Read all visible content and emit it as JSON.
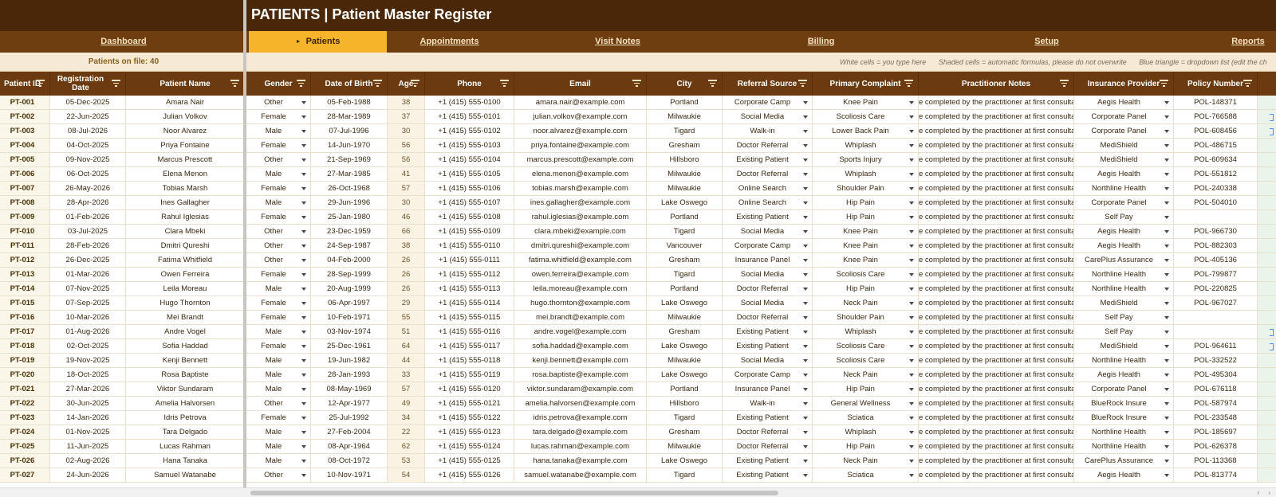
{
  "title": "PATIENTS  |  Patient Master Register",
  "nav": {
    "dashboard": "Dashboard",
    "patients": "Patients",
    "appointments": "Appointments",
    "visit_notes": "Visit Notes",
    "billing": "Billing",
    "setup": "Setup",
    "reports": "Reports"
  },
  "info": {
    "patients_on_file": "Patients on file: 40",
    "legend_white": "White cells = you type here",
    "legend_shaded": "Shaded cells = automatic formulas, please do not overwrite",
    "legend_dropdown": "Blue triangle = dropdown list (edit the ch"
  },
  "headers": {
    "patient_id": "Patient ID",
    "registration_date": "Registration Date",
    "patient_name": "Patient Name",
    "gender": "Gender",
    "date_of_birth": "Date of Birth",
    "age": "Age",
    "phone": "Phone",
    "email": "Email",
    "city": "City",
    "referral_source": "Referral Source",
    "primary_complaint": "Primary Complaint",
    "practitioner_notes": "Practitioner Notes",
    "insurance_provider": "Insurance Provider",
    "policy_number": "Policy Number"
  },
  "notes_text": "e completed by the practitioner at first consulta",
  "colors": {
    "title_bg": "#4a2708",
    "nav_bg": "#6e3d10",
    "active_tab": "#f6b42b",
    "header_bg": "#6b3a10",
    "info_bg": "#f6ead6"
  },
  "rows": [
    {
      "id": "PT-001",
      "reg": "05-Dec-2025",
      "name": "Amara Nair",
      "gender": "Other",
      "dob": "05-Feb-1988",
      "age": "38",
      "phone": "+1 (415) 555-0100",
      "email": "amara.nair@example.com",
      "city": "Portland",
      "referral": "Corporate Camp",
      "complaint": "Knee Pain",
      "insurance": "Aegis Health",
      "policy": "POL-148371",
      "mark": false
    },
    {
      "id": "PT-002",
      "reg": "22-Jun-2025",
      "name": "Julian Volkov",
      "gender": "Female",
      "dob": "28-Mar-1989",
      "age": "37",
      "phone": "+1 (415) 555-0101",
      "email": "julian.volkov@example.com",
      "city": "Milwaukie",
      "referral": "Social Media",
      "complaint": "Scoliosis Care",
      "insurance": "Corporate Panel",
      "policy": "POL-766588",
      "mark": true
    },
    {
      "id": "PT-003",
      "reg": "08-Jul-2026",
      "name": "Noor Alvarez",
      "gender": "Male",
      "dob": "07-Jul-1996",
      "age": "30",
      "phone": "+1 (415) 555-0102",
      "email": "noor.alvarez@example.com",
      "city": "Tigard",
      "referral": "Walk-in",
      "complaint": "Lower Back Pain",
      "insurance": "Corporate Panel",
      "policy": "POL-608456",
      "mark": true
    },
    {
      "id": "PT-004",
      "reg": "04-Oct-2025",
      "name": "Priya Fontaine",
      "gender": "Female",
      "dob": "14-Jun-1970",
      "age": "56",
      "phone": "+1 (415) 555-0103",
      "email": "priya.fontaine@example.com",
      "city": "Gresham",
      "referral": "Doctor Referral",
      "complaint": "Whiplash",
      "insurance": "MediShield",
      "policy": "POL-486715",
      "mark": false
    },
    {
      "id": "PT-005",
      "reg": "09-Nov-2025",
      "name": "Marcus Prescott",
      "gender": "Other",
      "dob": "21-Sep-1969",
      "age": "56",
      "phone": "+1 (415) 555-0104",
      "email": "marcus.prescott@example.com",
      "city": "Hillsboro",
      "referral": "Existing Patient",
      "complaint": "Sports Injury",
      "insurance": "MediShield",
      "policy": "POL-609634",
      "mark": false
    },
    {
      "id": "PT-006",
      "reg": "06-Oct-2025",
      "name": "Elena Menon",
      "gender": "Male",
      "dob": "27-Mar-1985",
      "age": "41",
      "phone": "+1 (415) 555-0105",
      "email": "elena.menon@example.com",
      "city": "Milwaukie",
      "referral": "Doctor Referral",
      "complaint": "Whiplash",
      "insurance": "Aegis Health",
      "policy": "POL-551812",
      "mark": false
    },
    {
      "id": "PT-007",
      "reg": "26-May-2026",
      "name": "Tobias Marsh",
      "gender": "Female",
      "dob": "26-Oct-1968",
      "age": "57",
      "phone": "+1 (415) 555-0106",
      "email": "tobias.marsh@example.com",
      "city": "Milwaukie",
      "referral": "Online Search",
      "complaint": "Shoulder Pain",
      "insurance": "Northline Health",
      "policy": "POL-240338",
      "mark": false
    },
    {
      "id": "PT-008",
      "reg": "28-Apr-2026",
      "name": "Ines Gallagher",
      "gender": "Male",
      "dob": "29-Jun-1996",
      "age": "30",
      "phone": "+1 (415) 555-0107",
      "email": "ines.gallagher@example.com",
      "city": "Lake Oswego",
      "referral": "Online Search",
      "complaint": "Hip Pain",
      "insurance": "Corporate Panel",
      "policy": "POL-504010",
      "mark": false
    },
    {
      "id": "PT-009",
      "reg": "01-Feb-2026",
      "name": "Rahul Iglesias",
      "gender": "Female",
      "dob": "25-Jan-1980",
      "age": "46",
      "phone": "+1 (415) 555-0108",
      "email": "rahul.iglesias@example.com",
      "city": "Portland",
      "referral": "Existing Patient",
      "complaint": "Hip Pain",
      "insurance": "Self Pay",
      "policy": "",
      "mark": false
    },
    {
      "id": "PT-010",
      "reg": "03-Jul-2025",
      "name": "Clara Mbeki",
      "gender": "Other",
      "dob": "23-Dec-1959",
      "age": "66",
      "phone": "+1 (415) 555-0109",
      "email": "clara.mbeki@example.com",
      "city": "Tigard",
      "referral": "Social Media",
      "complaint": "Knee Pain",
      "insurance": "Aegis Health",
      "policy": "POL-966730",
      "mark": false
    },
    {
      "id": "PT-011",
      "reg": "28-Feb-2026",
      "name": "Dmitri Qureshi",
      "gender": "Other",
      "dob": "24-Sep-1987",
      "age": "38",
      "phone": "+1 (415) 555-0110",
      "email": "dmitri.qureshi@example.com",
      "city": "Vancouver",
      "referral": "Corporate Camp",
      "complaint": "Knee Pain",
      "insurance": "Aegis Health",
      "policy": "POL-882303",
      "mark": false
    },
    {
      "id": "PT-012",
      "reg": "26-Dec-2025",
      "name": "Fatima Whitfield",
      "gender": "Other",
      "dob": "04-Feb-2000",
      "age": "26",
      "phone": "+1 (415) 555-0111",
      "email": "fatima.whitfield@example.com",
      "city": "Gresham",
      "referral": "Insurance Panel",
      "complaint": "Knee Pain",
      "insurance": "CarePlus Assurance",
      "policy": "POL-405136",
      "mark": false
    },
    {
      "id": "PT-013",
      "reg": "01-Mar-2026",
      "name": "Owen Ferreira",
      "gender": "Female",
      "dob": "28-Sep-1999",
      "age": "26",
      "phone": "+1 (415) 555-0112",
      "email": "owen.ferreira@example.com",
      "city": "Tigard",
      "referral": "Social Media",
      "complaint": "Scoliosis Care",
      "insurance": "Northline Health",
      "policy": "POL-799877",
      "mark": false
    },
    {
      "id": "PT-014",
      "reg": "07-Nov-2025",
      "name": "Leila Moreau",
      "gender": "Male",
      "dob": "20-Aug-1999",
      "age": "26",
      "phone": "+1 (415) 555-0113",
      "email": "leila.moreau@example.com",
      "city": "Portland",
      "referral": "Doctor Referral",
      "complaint": "Hip Pain",
      "insurance": "Northline Health",
      "policy": "POL-220825",
      "mark": false
    },
    {
      "id": "PT-015",
      "reg": "07-Sep-2025",
      "name": "Hugo Thornton",
      "gender": "Female",
      "dob": "06-Apr-1997",
      "age": "29",
      "phone": "+1 (415) 555-0114",
      "email": "hugo.thornton@example.com",
      "city": "Lake Oswego",
      "referral": "Social Media",
      "complaint": "Neck Pain",
      "insurance": "MediShield",
      "policy": "POL-967027",
      "mark": false
    },
    {
      "id": "PT-016",
      "reg": "10-Mar-2026",
      "name": "Mei Brandt",
      "gender": "Female",
      "dob": "10-Feb-1971",
      "age": "55",
      "phone": "+1 (415) 555-0115",
      "email": "mei.brandt@example.com",
      "city": "Milwaukie",
      "referral": "Doctor Referral",
      "complaint": "Shoulder Pain",
      "insurance": "Self Pay",
      "policy": "",
      "mark": false
    },
    {
      "id": "PT-017",
      "reg": "01-Aug-2026",
      "name": "Andre Vogel",
      "gender": "Male",
      "dob": "03-Nov-1974",
      "age": "51",
      "phone": "+1 (415) 555-0116",
      "email": "andre.vogel@example.com",
      "city": "Gresham",
      "referral": "Existing Patient",
      "complaint": "Whiplash",
      "insurance": "Self Pay",
      "policy": "",
      "mark": true
    },
    {
      "id": "PT-018",
      "reg": "02-Oct-2025",
      "name": "Sofia Haddad",
      "gender": "Female",
      "dob": "25-Dec-1961",
      "age": "64",
      "phone": "+1 (415) 555-0117",
      "email": "sofia.haddad@example.com",
      "city": "Lake Oswego",
      "referral": "Existing Patient",
      "complaint": "Scoliosis Care",
      "insurance": "MediShield",
      "policy": "POL-964611",
      "mark": true
    },
    {
      "id": "PT-019",
      "reg": "19-Nov-2025",
      "name": "Kenji Bennett",
      "gender": "Male",
      "dob": "19-Jun-1982",
      "age": "44",
      "phone": "+1 (415) 555-0118",
      "email": "kenji.bennett@example.com",
      "city": "Milwaukie",
      "referral": "Social Media",
      "complaint": "Scoliosis Care",
      "insurance": "Northline Health",
      "policy": "POL-332522",
      "mark": false
    },
    {
      "id": "PT-020",
      "reg": "18-Oct-2025",
      "name": "Rosa Baptiste",
      "gender": "Male",
      "dob": "28-Jan-1993",
      "age": "33",
      "phone": "+1 (415) 555-0119",
      "email": "rosa.baptiste@example.com",
      "city": "Lake Oswego",
      "referral": "Corporate Camp",
      "complaint": "Neck Pain",
      "insurance": "Aegis Health",
      "policy": "POL-495304",
      "mark": false
    },
    {
      "id": "PT-021",
      "reg": "27-Mar-2026",
      "name": "Viktor Sundaram",
      "gender": "Male",
      "dob": "08-May-1969",
      "age": "57",
      "phone": "+1 (415) 555-0120",
      "email": "viktor.sundaram@example.com",
      "city": "Portland",
      "referral": "Insurance Panel",
      "complaint": "Hip Pain",
      "insurance": "Corporate Panel",
      "policy": "POL-676118",
      "mark": false
    },
    {
      "id": "PT-022",
      "reg": "30-Jun-2025",
      "name": "Amelia Halvorsen",
      "gender": "Other",
      "dob": "12-Apr-1977",
      "age": "49",
      "phone": "+1 (415) 555-0121",
      "email": "amelia.halvorsen@example.com",
      "city": "Hillsboro",
      "referral": "Walk-in",
      "complaint": "General Wellness",
      "insurance": "BlueRock Insure",
      "policy": "POL-587974",
      "mark": false
    },
    {
      "id": "PT-023",
      "reg": "14-Jan-2026",
      "name": "Idris Petrova",
      "gender": "Female",
      "dob": "25-Jul-1992",
      "age": "34",
      "phone": "+1 (415) 555-0122",
      "email": "idris.petrova@example.com",
      "city": "Tigard",
      "referral": "Existing Patient",
      "complaint": "Sciatica",
      "insurance": "BlueRock Insure",
      "policy": "POL-233548",
      "mark": false
    },
    {
      "id": "PT-024",
      "reg": "01-Nov-2025",
      "name": "Tara Delgado",
      "gender": "Male",
      "dob": "27-Feb-2004",
      "age": "22",
      "phone": "+1 (415) 555-0123",
      "email": "tara.delgado@example.com",
      "city": "Gresham",
      "referral": "Doctor Referral",
      "complaint": "Whiplash",
      "insurance": "Northline Health",
      "policy": "POL-185697",
      "mark": false
    },
    {
      "id": "PT-025",
      "reg": "11-Jun-2025",
      "name": "Lucas Rahman",
      "gender": "Male",
      "dob": "08-Apr-1964",
      "age": "62",
      "phone": "+1 (415) 555-0124",
      "email": "lucas.rahman@example.com",
      "city": "Milwaukie",
      "referral": "Doctor Referral",
      "complaint": "Hip Pain",
      "insurance": "Northline Health",
      "policy": "POL-626378",
      "mark": false
    },
    {
      "id": "PT-026",
      "reg": "02-Aug-2026",
      "name": "Hana Tanaka",
      "gender": "Male",
      "dob": "08-Oct-1972",
      "age": "53",
      "phone": "+1 (415) 555-0125",
      "email": "hana.tanaka@example.com",
      "city": "Lake Oswego",
      "referral": "Existing Patient",
      "complaint": "Neck Pain",
      "insurance": "CarePlus Assurance",
      "policy": "POL-113368",
      "mark": false
    },
    {
      "id": "PT-027",
      "reg": "24-Jun-2026",
      "name": "Samuel Watanabe",
      "gender": "Other",
      "dob": "10-Nov-1971",
      "age": "54",
      "phone": "+1 (415) 555-0126",
      "email": "samuel.watanabe@example.com",
      "city": "Tigard",
      "referral": "Existing Patient",
      "complaint": "Sciatica",
      "insurance": "Aegis Health",
      "policy": "POL-813774",
      "mark": false
    }
  ]
}
